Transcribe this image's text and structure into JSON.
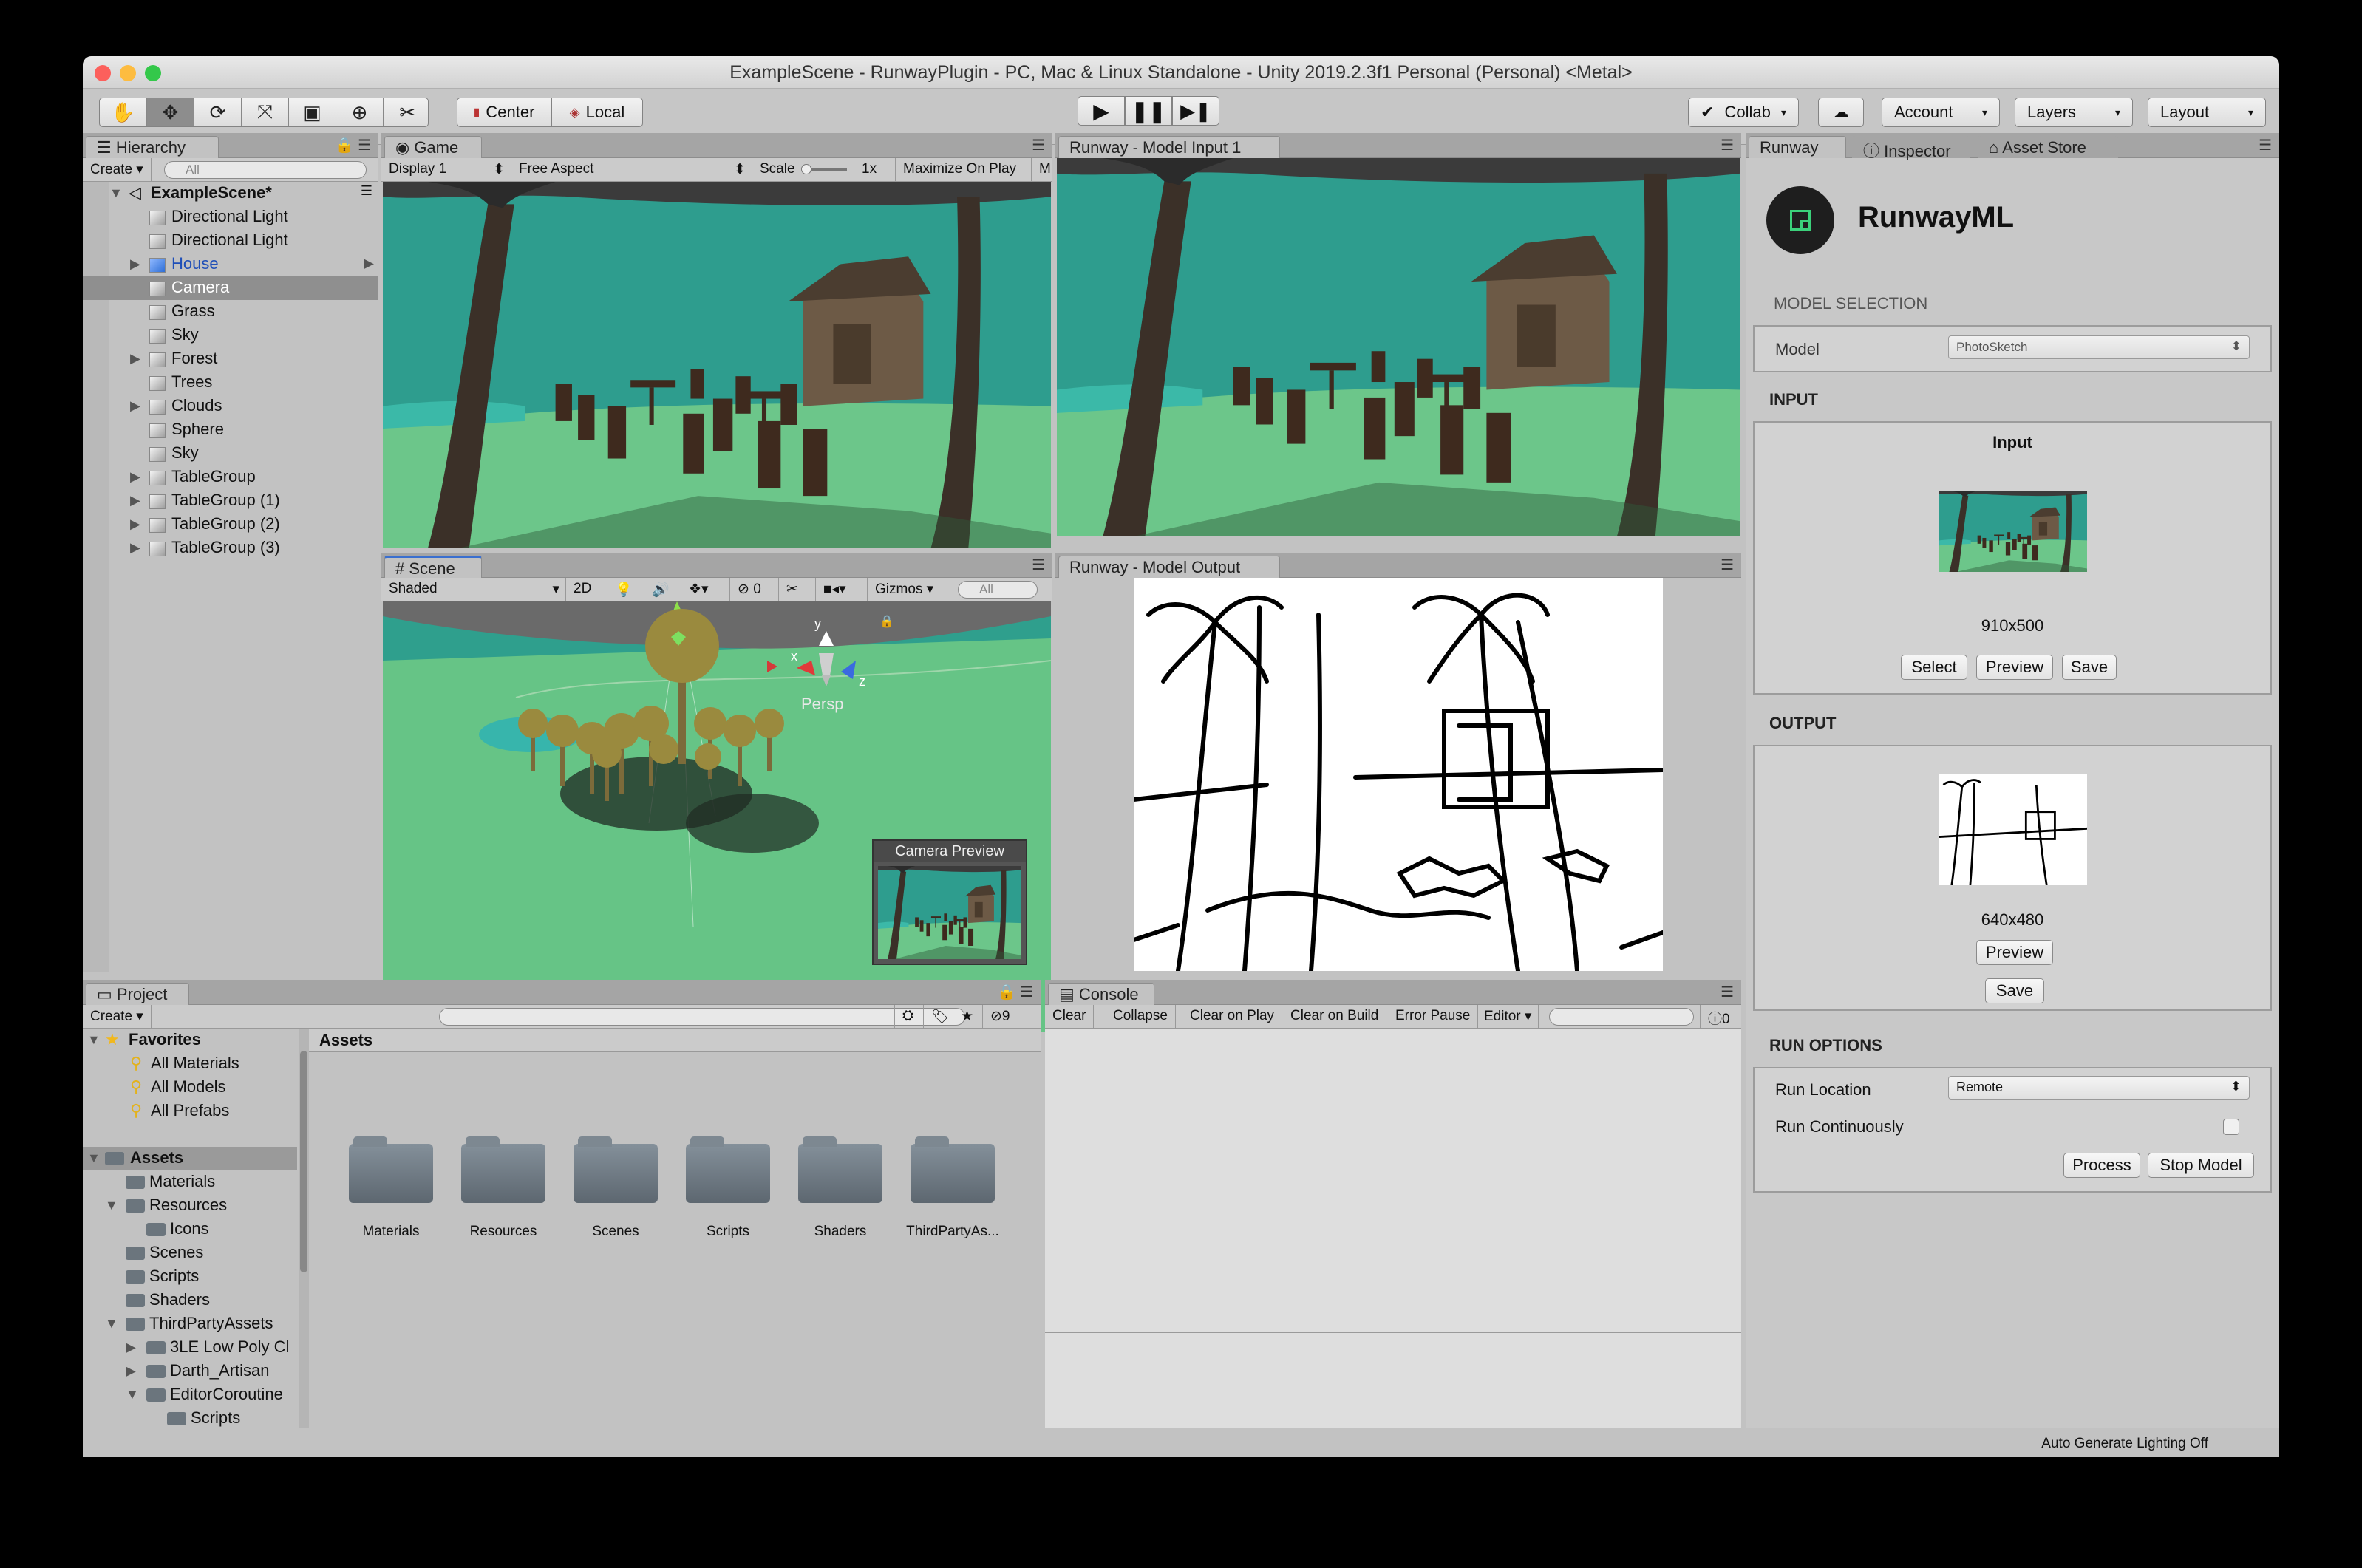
{
  "window": {
    "title": "ExampleScene - RunwayPlugin - PC, Mac & Linux Standalone - Unity 2019.2.3f1 Personal (Personal) <Metal>"
  },
  "toolbar": {
    "pivot_label": "Center",
    "space_label": "Local",
    "collab_label": "Collab",
    "account_label": "Account",
    "layers_label": "Layers",
    "layout_label": "Layout"
  },
  "hierarchy": {
    "tab": "Hierarchy",
    "create": "Create",
    "search_placeholder": "All",
    "scene": "ExampleScene*",
    "items": [
      "Directional Light",
      "Directional Light",
      "House",
      "Camera",
      "Grass",
      "Sky",
      "Forest",
      "Trees",
      "Clouds",
      "Sphere",
      "Sky",
      "TableGroup",
      "TableGroup (1)",
      "TableGroup (2)",
      "TableGroup (3)"
    ]
  },
  "game": {
    "tab": "Game",
    "display": "Display 1",
    "aspect": "Free Aspect",
    "scale_label": "Scale",
    "scale_value": "1x",
    "maximize": "Maximize On Play",
    "more": "M"
  },
  "model_input_tab": "Runway - Model Input 1",
  "model_output_tab": "Runway - Model Output",
  "scene": {
    "tab": "Scene",
    "shading": "Shaded",
    "mode2d": "2D",
    "hidden_count": "0",
    "gizmos": "Gizmos",
    "search_placeholder": "All",
    "persp": "Persp",
    "axis_y": "y",
    "axis_x": "x",
    "axis_z": "z",
    "camera_preview": "Camera Preview"
  },
  "project": {
    "tab": "Project",
    "create": "Create",
    "hidden_count": "9",
    "favorites_label": "Favorites",
    "favorites": [
      "All Materials",
      "All Models",
      "All Prefabs"
    ],
    "assets_label": "Assets",
    "tree": [
      "Materials",
      "Resources",
      "Icons",
      "Scenes",
      "Scripts",
      "Shaders",
      "ThirdPartyAssets",
      "3LE Low Poly Cl",
      "Darth_Artisan",
      "EditorCoroutine",
      "Scripts"
    ],
    "breadcrumb": "Assets",
    "folders": [
      "Materials",
      "Resources",
      "Scenes",
      "Scripts",
      "Shaders",
      "ThirdPartyAs..."
    ]
  },
  "console": {
    "tab": "Console",
    "clear": "Clear",
    "collapse": "Collapse",
    "clear_on_play": "Clear on Play",
    "clear_on_build": "Clear on Build",
    "error_pause": "Error Pause",
    "editor": "Editor",
    "count": "0"
  },
  "runway": {
    "tab": "Runway",
    "inspector_tab": "Inspector",
    "asset_store_tab": "Asset Store",
    "brand": "RunwayML",
    "model_selection": "MODEL SELECTION",
    "model_label": "Model",
    "model_value": "PhotoSketch",
    "input_heading": "INPUT",
    "input_title": "Input",
    "input_size": "910x500",
    "select_btn": "Select",
    "preview_btn": "Preview",
    "save_btn": "Save",
    "output_heading": "OUTPUT",
    "output_size": "640x480",
    "output_preview_btn": "Preview",
    "output_save_btn": "Save",
    "run_options": "RUN OPTIONS",
    "run_location_label": "Run Location",
    "run_location_value": "Remote",
    "run_continuously_label": "Run Continuously",
    "process_btn": "Process",
    "stop_btn": "Stop Model"
  },
  "status": {
    "text": "Auto Generate Lighting Off"
  },
  "colors": {
    "sky": "#2fa392",
    "grass": "#6fc988",
    "selection": "#3a6fcf",
    "runway_dark": "#1e1e1e"
  }
}
